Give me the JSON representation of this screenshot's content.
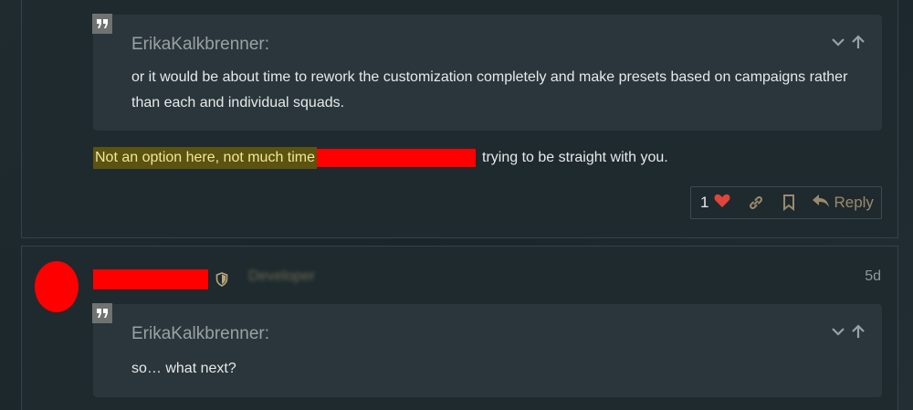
{
  "posts": [
    {
      "quote": {
        "author": "ErikaKalkbrenner:",
        "text": "or it would be about time to rework the customization completely and make presets based on campaigns rather than each and individual squads."
      },
      "body": {
        "highlighted": "Not an option here, not much time",
        "rest": "trying to be straight with you."
      },
      "actions": {
        "like_count": "1",
        "reply_label": "Reply"
      }
    },
    {
      "author_role": "Developer",
      "date": "5d",
      "quote": {
        "author": "ErikaKalkbrenner:",
        "text": "so… what next?"
      }
    }
  ],
  "colors": {
    "background": "#1d282c",
    "quote_bg": "#2a363b",
    "highlight_bg": "#5b5310",
    "redaction": "#ff0000",
    "heart": "#e0453c",
    "action_text": "#9a8a6b"
  },
  "icons": [
    "quote-icon",
    "chevron-down-icon",
    "arrow-up-icon",
    "heart-icon",
    "link-icon",
    "bookmark-icon",
    "reply-icon",
    "shield-icon"
  ]
}
